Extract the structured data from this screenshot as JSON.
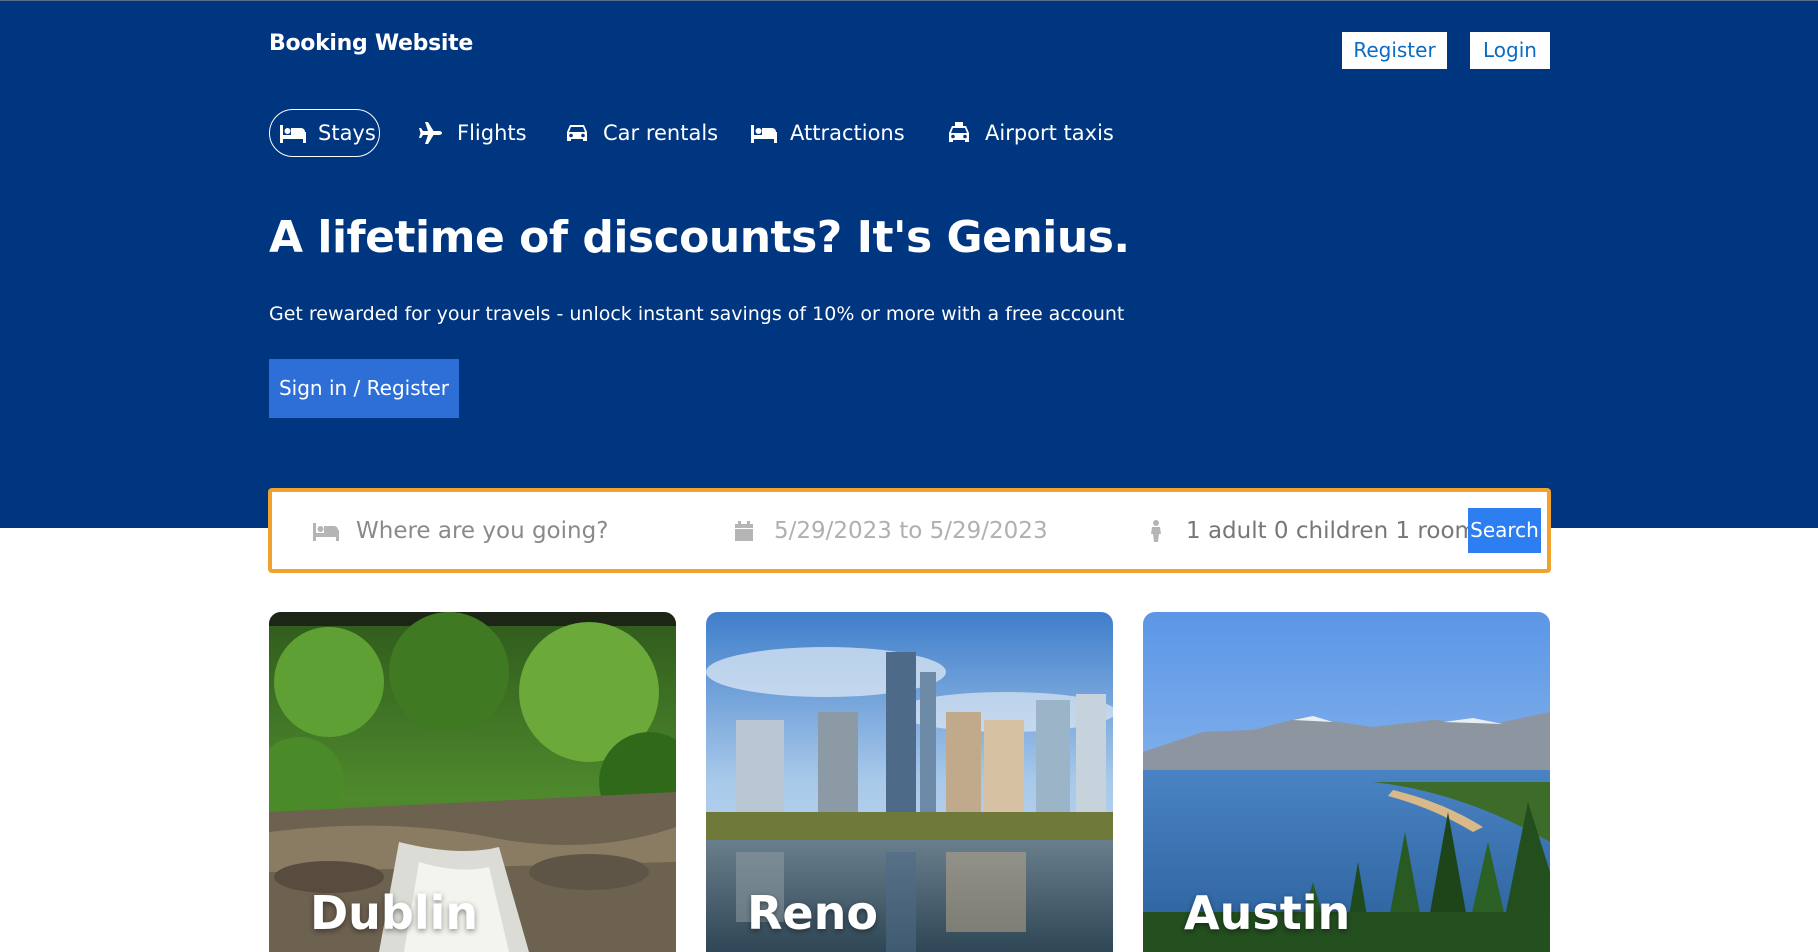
{
  "header": {
    "brand": "Booking Website",
    "register_label": "Register",
    "login_label": "Login"
  },
  "nav": {
    "items": [
      {
        "label": "Stays",
        "icon": "bed-icon",
        "active": true
      },
      {
        "label": "Flights",
        "icon": "plane-icon",
        "active": false
      },
      {
        "label": "Car rentals",
        "icon": "car-icon",
        "active": false
      },
      {
        "label": "Attractions",
        "icon": "bed-icon",
        "active": false
      },
      {
        "label": "Airport taxis",
        "icon": "taxi-icon",
        "active": false
      }
    ]
  },
  "hero": {
    "headline": "A lifetime of discounts? It's Genius.",
    "subline": "Get rewarded for your travels - unlock instant savings of 10% or more with a free account",
    "signin_label": "Sign in / Register"
  },
  "search": {
    "destination_placeholder": "Where are you going?",
    "dates": "5/29/2023 to 5/29/2023",
    "guests": "1 adult 0 children 1 room",
    "search_label": "Search"
  },
  "destinations": [
    {
      "name": "Dublin"
    },
    {
      "name": "Reno"
    },
    {
      "name": "Austin"
    }
  ],
  "colors": {
    "hero_bg": "#003580",
    "primary_button": "#2d6fd6",
    "search_border": "#f0a22f",
    "search_button": "#2d7ef0"
  }
}
